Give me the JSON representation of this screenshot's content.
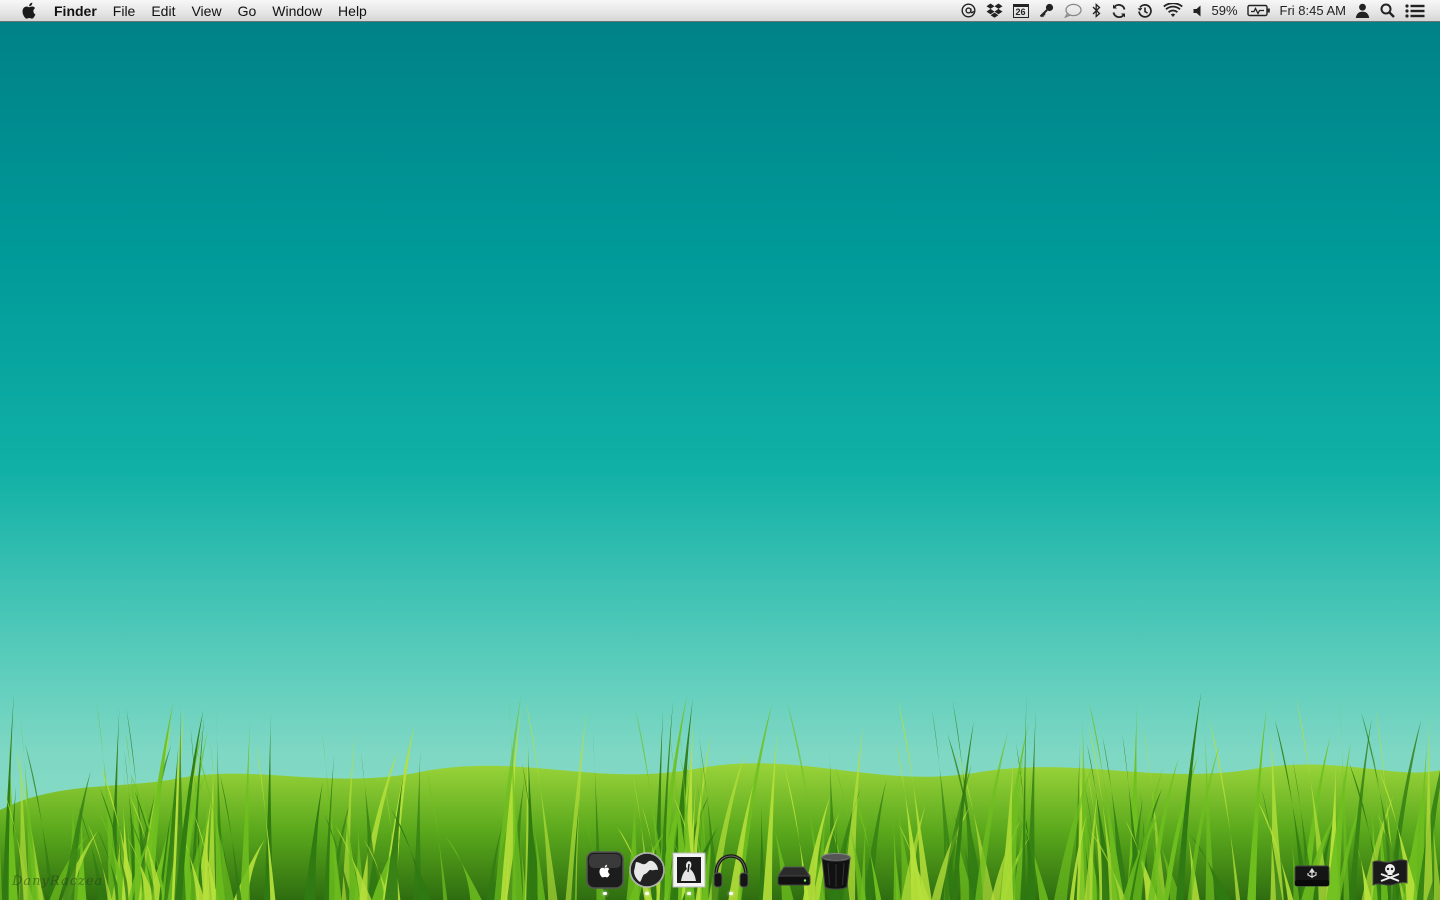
{
  "menubar": {
    "app_name": "Finder",
    "menus": [
      "File",
      "Edit",
      "View",
      "Go",
      "Window",
      "Help"
    ],
    "status": {
      "calendar_day": "26",
      "battery_percent": "59%",
      "clock": "Fri 8:45 AM"
    },
    "status_icons": [
      "at-sign-icon",
      "dropbox-icon",
      "calendar-icon",
      "key-icon",
      "chat-bubble-icon",
      "bluetooth-icon",
      "sync-icon",
      "time-machine-icon",
      "wifi-icon",
      "volume-icon",
      "battery-icon",
      "user-icon",
      "spotlight-search-icon",
      "notification-list-icon"
    ]
  },
  "wallpaper": {
    "sky_colors": [
      "#007f86",
      "#4ec8b8",
      "#8fdcc3"
    ],
    "grass_colors": [
      "#2f7a12",
      "#6fbf1f",
      "#b6e03a"
    ],
    "signature": "DanyRaczea"
  },
  "dock": {
    "apps": [
      "apple-system-app-icon",
      "globe-browser-icon",
      "photo-stamp-icon",
      "headphones-music-icon"
    ],
    "utilities": [
      "hard-drive-icon",
      "trash-icon"
    ],
    "right_items": [
      "usb-drive-icon",
      "pirate-flag-icon"
    ],
    "running_indicators": 4
  }
}
